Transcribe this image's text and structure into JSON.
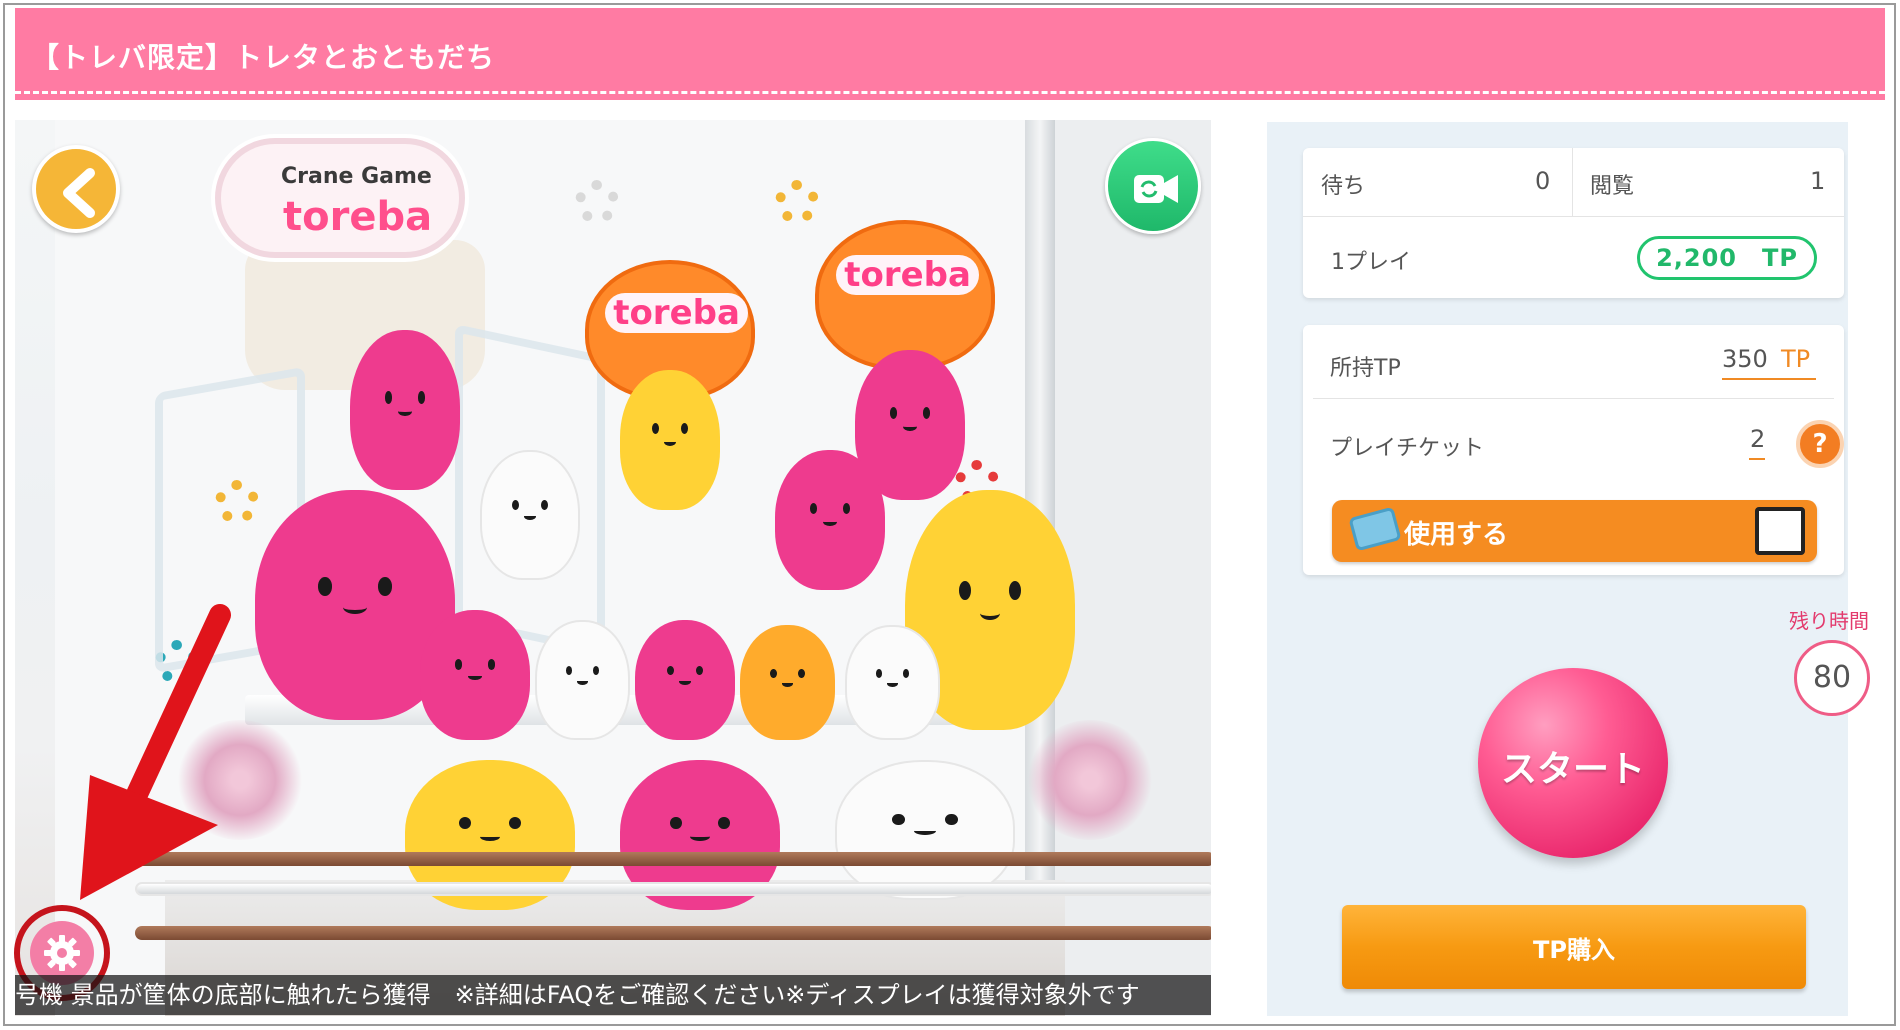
{
  "banner": {
    "title": "【トレバ限定】トレタとおともだち"
  },
  "camera": {
    "logo_line1": "Crane Game",
    "logo_line2": "toreba",
    "bag_label": "toreba",
    "ticker": "号機 景品が筐体の底部に触れたら獲得　※詳細はFAQをご確認ください※ディスプレイは獲得対象外です",
    "back_icon": "chevron-left-icon",
    "switch_camera_icon": "switch-camera-icon",
    "settings_icon": "gear-icon"
  },
  "stats": {
    "waiting_label": "待ち",
    "waiting_value": "0",
    "viewing_label": "閲覧",
    "viewing_value": "1",
    "play_label": "1プレイ",
    "play_price": "2,200　TP"
  },
  "wallet": {
    "owned_label": "所持TP",
    "owned_value": "350",
    "owned_unit": "TP",
    "ticket_label": "プレイチケット",
    "ticket_value": "2",
    "help_label": "?",
    "use_label": "使用する"
  },
  "timer": {
    "label": "残り時間",
    "value": "80"
  },
  "actions": {
    "start_label": "スタート",
    "buy_label": "TP購入"
  },
  "colors": {
    "banner": "#ff7ba3",
    "accent_green": "#21c46e",
    "accent_orange": "#f58c21",
    "start_pink": "#ff5c93"
  }
}
